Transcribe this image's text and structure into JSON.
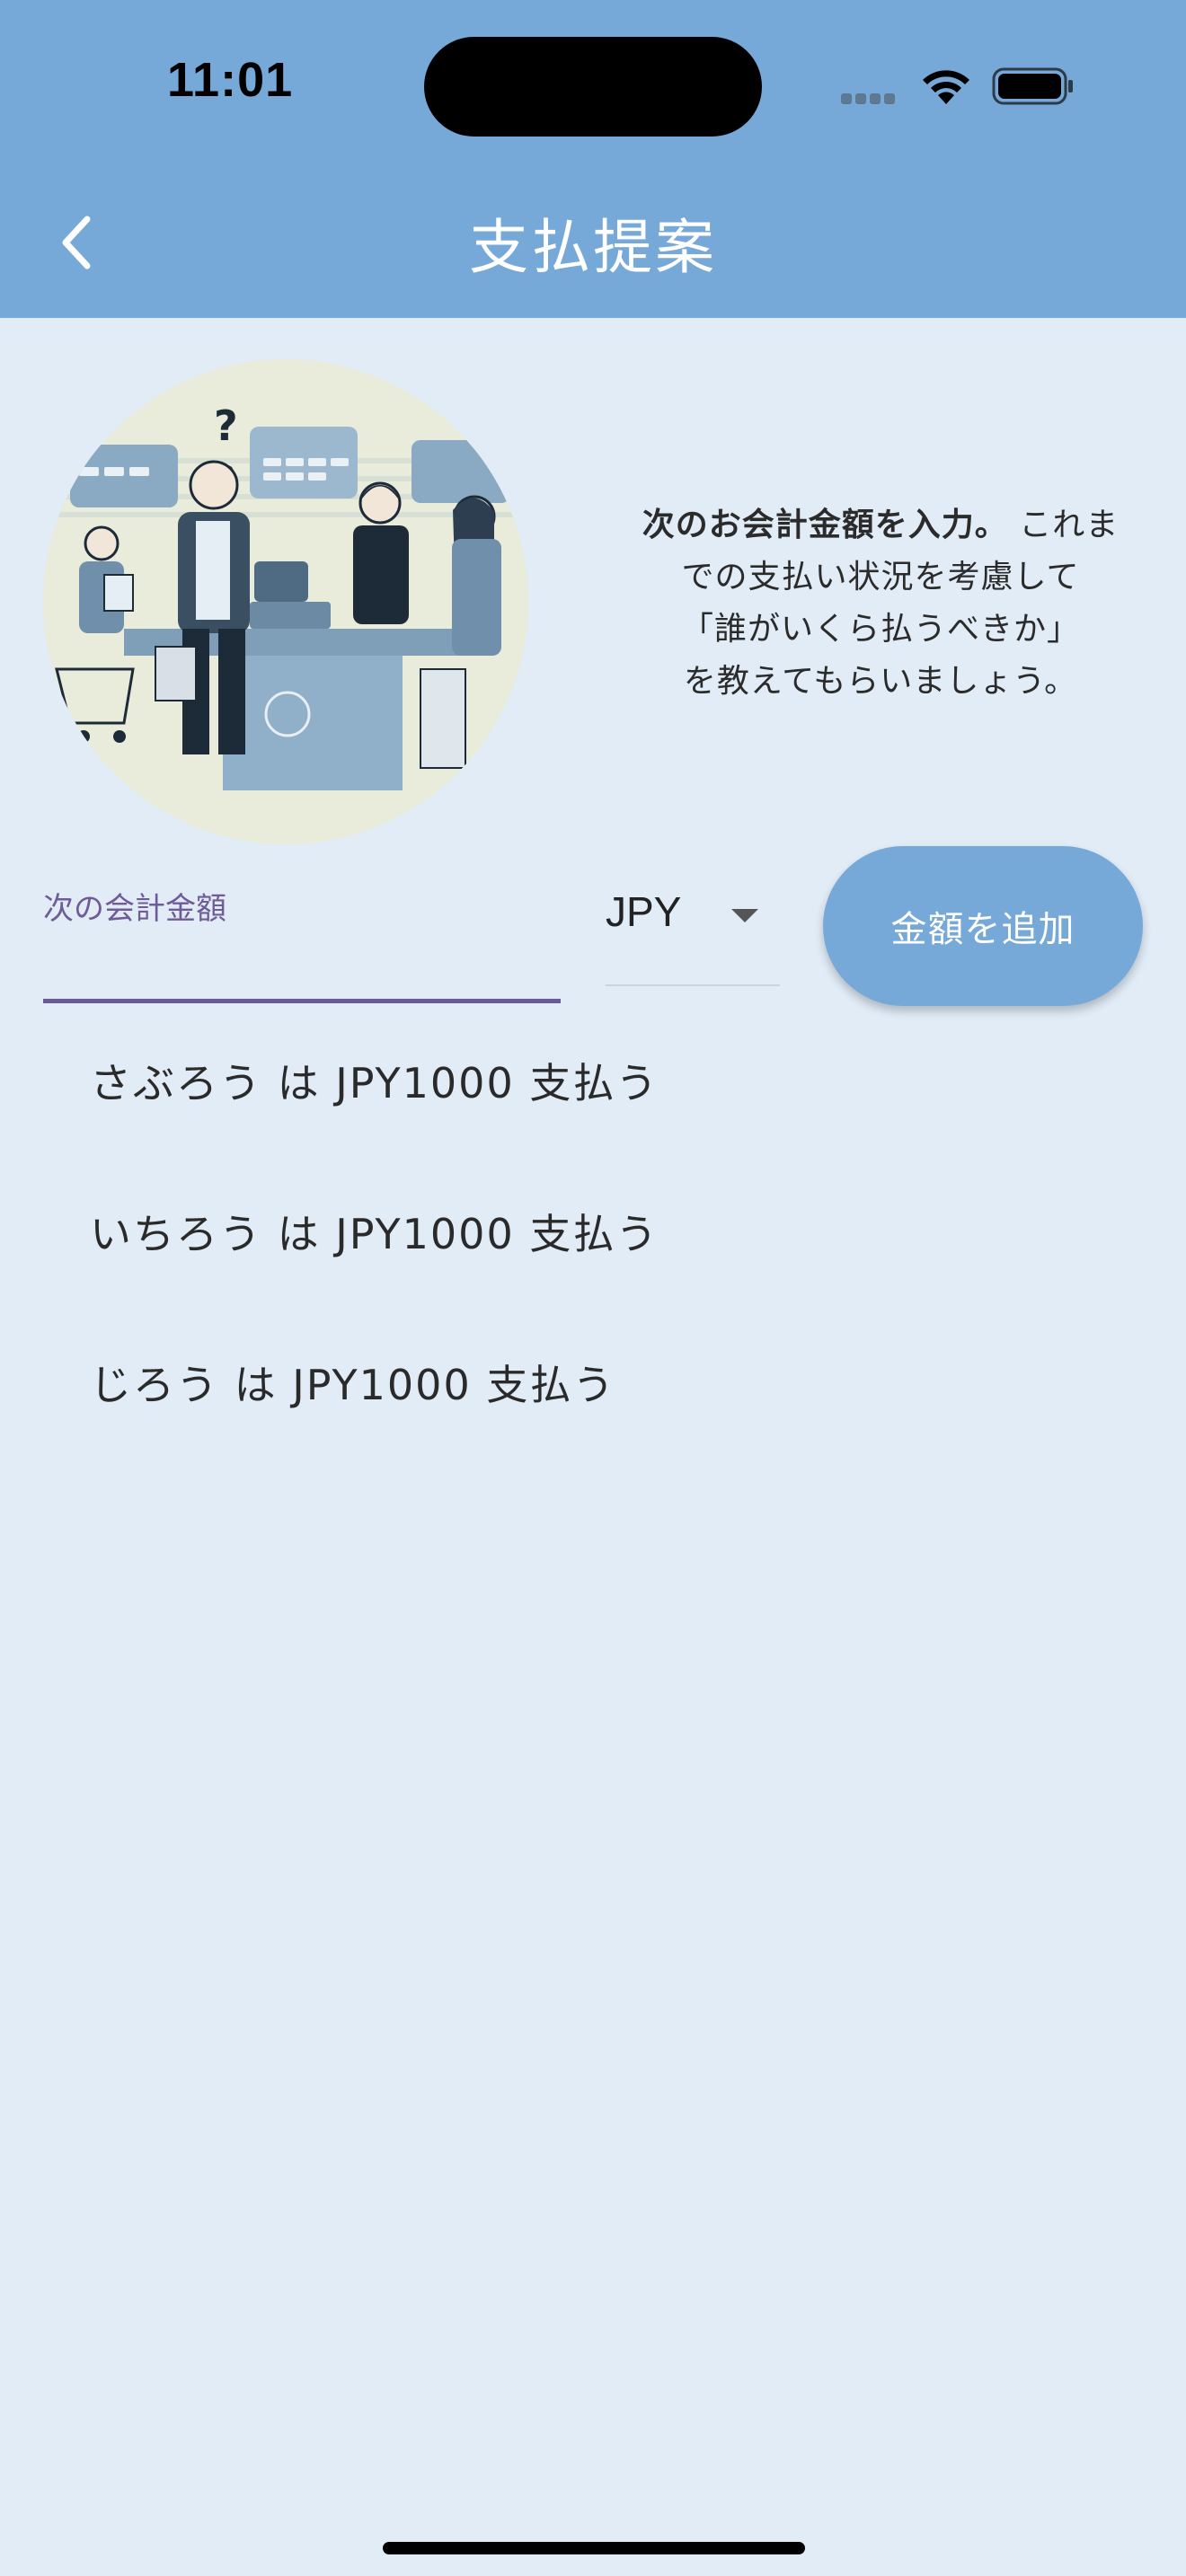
{
  "status_bar": {
    "time": "11:01"
  },
  "header": {
    "title": "支払提案",
    "background_color": "#76a8d8"
  },
  "intro": {
    "bold_text": "次のお会計金額を入力。",
    "body_text": "これまでの支払い状況を考慮して「誰がいくら払うべきか」を教えてもらいましょう。",
    "lines": [
      "これま",
      "での支払い状況を考慮して",
      "「誰がいくら払うべきか」",
      "を教えてもらいましょう。"
    ]
  },
  "form": {
    "amount_label": "次の会計金額",
    "amount_value": "",
    "currency": "JPY",
    "add_button_label": "金額を追加"
  },
  "suggestions": [
    {
      "text": "さぶろう は JPY1000 支払う"
    },
    {
      "text": "いちろう は JPY1000 支払う"
    },
    {
      "text": "じろう は JPY1000 支払う"
    }
  ],
  "colors": {
    "accent": "#76a8d8",
    "page_background": "#e1ecf7",
    "label_purple": "#6f5b97"
  }
}
